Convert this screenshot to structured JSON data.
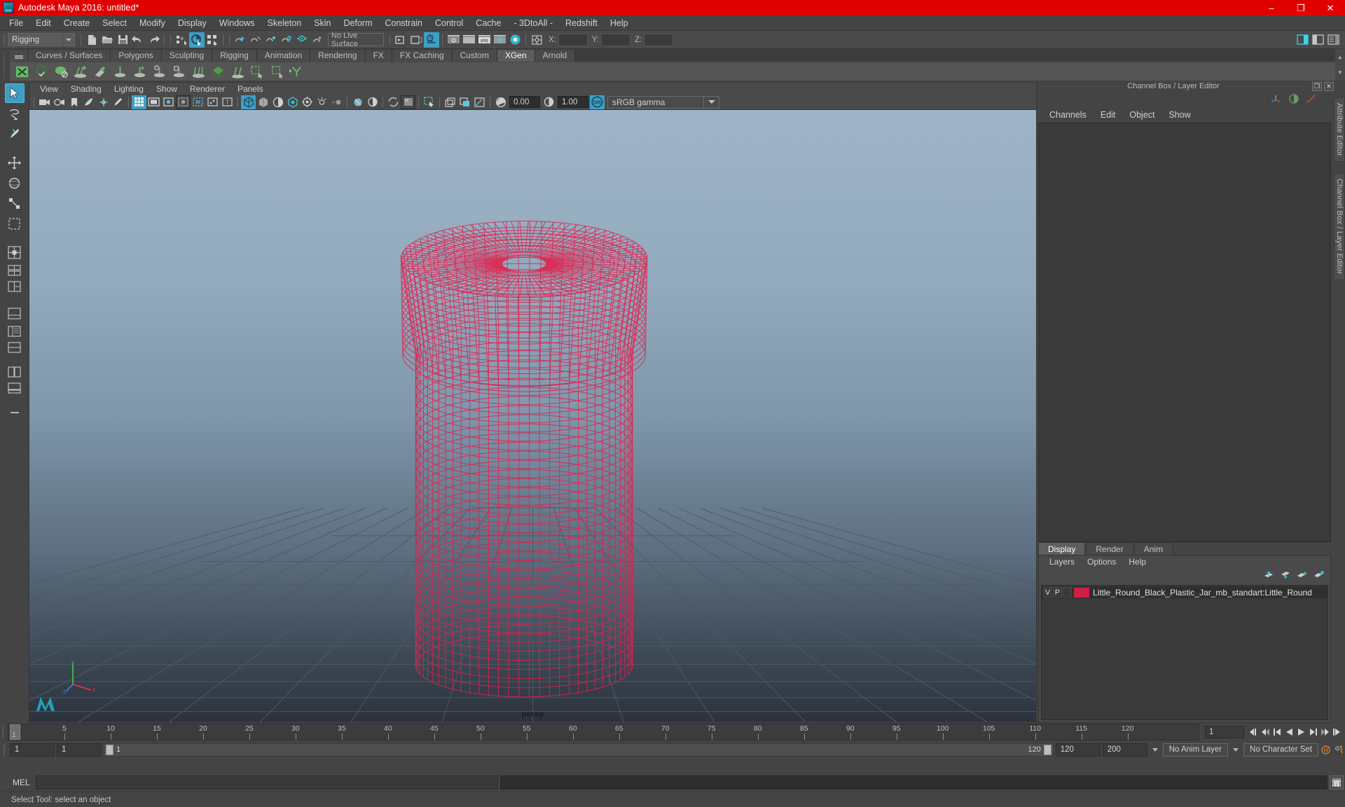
{
  "titlebar": {
    "title": "Autodesk Maya 2016: untitled*",
    "minimize": "–",
    "maximize": "❐",
    "close": "✕"
  },
  "menubar": {
    "items": [
      "File",
      "Edit",
      "Create",
      "Select",
      "Modify",
      "Display",
      "Windows",
      "Skeleton",
      "Skin",
      "Deform",
      "Constrain",
      "Control",
      "Cache",
      "- 3DtoAll -",
      "Redshift",
      "Help"
    ]
  },
  "statusline": {
    "mode": "Rigging",
    "live_surface": "No Live Surface",
    "coord_x_label": "X:",
    "coord_y_label": "Y:",
    "coord_z_label": "Z:",
    "coord_x": "",
    "coord_y": "",
    "coord_z": ""
  },
  "shelf": {
    "tabs": [
      "Curves / Surfaces",
      "Polygons",
      "Sculpting",
      "Rigging",
      "Animation",
      "Rendering",
      "FX",
      "FX Caching",
      "Custom",
      "XGen",
      "Arnold"
    ],
    "active_tab": "XGen",
    "icon_count": 14
  },
  "toolbox": {
    "tools": [
      "select-tool",
      "lasso-select-tool",
      "paint-select-tool",
      "move-tool",
      "rotate-tool",
      "scale-tool",
      "soft-select-tool",
      "last-tool-1",
      "four-view-layout",
      "two-panes-stacked",
      "two-panes-side",
      "single-perspective",
      "outliner-persp",
      "hypergraph-persp",
      "persp-graph"
    ]
  },
  "viewport": {
    "menus": [
      "View",
      "Shading",
      "Lighting",
      "Show",
      "Renderer",
      "Panels"
    ],
    "exposure_value": "0.00",
    "gamma_value": "1.00",
    "color_management": "sRGB gamma",
    "camera_label": "persp",
    "axis_x": "x",
    "axis_y": "y",
    "axis_z": "z"
  },
  "rightpanel": {
    "title": "Channel Box / Layer Editor",
    "restore_glyph": "❐",
    "close_glyph": "✕",
    "channel_tabs": [
      "Channels",
      "Edit",
      "Object",
      "Show"
    ],
    "layer_tabs": [
      "Display",
      "Render",
      "Anim"
    ],
    "active_layer_tab": "Display",
    "layer_menus": [
      "Layers",
      "Options",
      "Help"
    ],
    "layers": [
      {
        "visible": "V",
        "playback": "P",
        "color": "#cf1f45",
        "name": "Little_Round_Black_Plastic_Jar_mb_standart:Little_Round"
      }
    ],
    "side_tabs": [
      "Attribute Editor",
      "Channel Box / Layer Editor"
    ]
  },
  "timeline": {
    "ticks": [
      5,
      10,
      15,
      20,
      25,
      30,
      35,
      40,
      45,
      50,
      55,
      60,
      65,
      70,
      75,
      80,
      85,
      90,
      95,
      100,
      105,
      110,
      115,
      120
    ],
    "current_frame": "1",
    "frame_field": "1",
    "range_start": "1",
    "range_current": "1",
    "range_bar_start": "1",
    "range_bar_end": "120",
    "anim_end": "120",
    "playback_end": "200",
    "anim_layer": "No Anim Layer",
    "character_set": "No Character Set"
  },
  "commandline": {
    "language": "MEL",
    "input_value": "",
    "output_value": ""
  },
  "helpline": {
    "text": "Select Tool: select an object"
  },
  "colors": {
    "title_red": "#e00000",
    "accent_blue": "#3e9fc4",
    "wireframe_red": "#e0214d",
    "shelf_green": "#4a9a4a",
    "panel_bg": "#444444"
  }
}
